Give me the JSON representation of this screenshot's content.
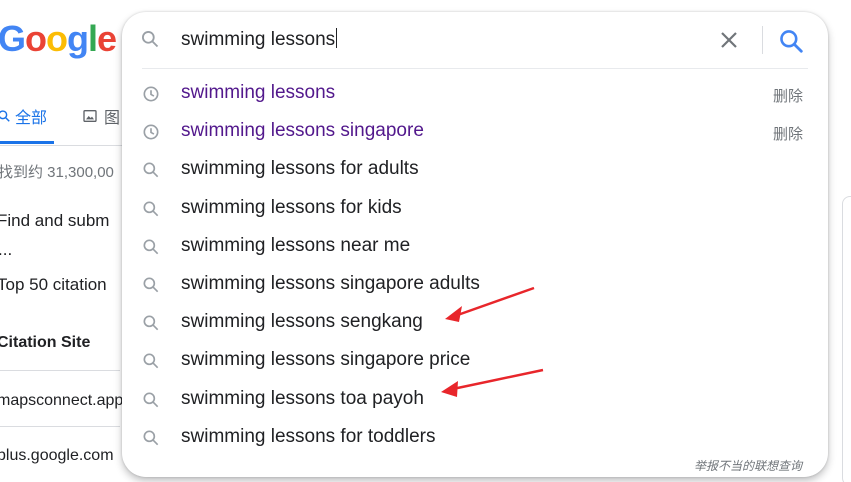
{
  "logo": {
    "text": "Google",
    "letters": [
      "G",
      "o",
      "o",
      "g",
      "l",
      "e"
    ],
    "colors": [
      "#4285f4",
      "#ea4335",
      "#fbbc05",
      "#4285f4",
      "#34a853",
      "#ea4335"
    ]
  },
  "tabs": {
    "all_label": "全部",
    "images_label": "图"
  },
  "background": {
    "result_stats": "找到约 31,300,00",
    "line1": "Find and subm",
    "line2": "...",
    "line3": "Top 50 citation",
    "line4": "Citation Site",
    "line5": "mapsconnect.app",
    "line6": "plus.google.com"
  },
  "search": {
    "query": "swimming lessons",
    "suggestions": [
      {
        "text": "swimming lessons",
        "type": "history",
        "delete_label": "删除",
        "icon": "history-clock-icon"
      },
      {
        "text": "swimming lessons singapore",
        "type": "history",
        "delete_label": "删除",
        "icon": "history-clock-icon"
      },
      {
        "text": "swimming lessons for adults",
        "type": "query",
        "icon": "search-icon"
      },
      {
        "text": "swimming lessons for kids",
        "type": "query",
        "icon": "search-icon"
      },
      {
        "text": "swimming lessons near me",
        "type": "query",
        "icon": "search-icon"
      },
      {
        "text": "swimming lessons singapore adults",
        "type": "query",
        "icon": "search-icon"
      },
      {
        "text": "swimming lessons sengkang",
        "type": "query",
        "icon": "search-icon"
      },
      {
        "text": "swimming lessons singapore price",
        "type": "query",
        "icon": "search-icon"
      },
      {
        "text": "swimming lessons toa payoh",
        "type": "query",
        "icon": "search-icon"
      },
      {
        "text": "swimming lessons for toddlers",
        "type": "query",
        "icon": "search-icon"
      }
    ],
    "report_label": "举报不当的联想查询"
  },
  "colors": {
    "accent": "#1a73e8",
    "history_text": "#52188c",
    "annotation_arrow": "#e8262b"
  }
}
